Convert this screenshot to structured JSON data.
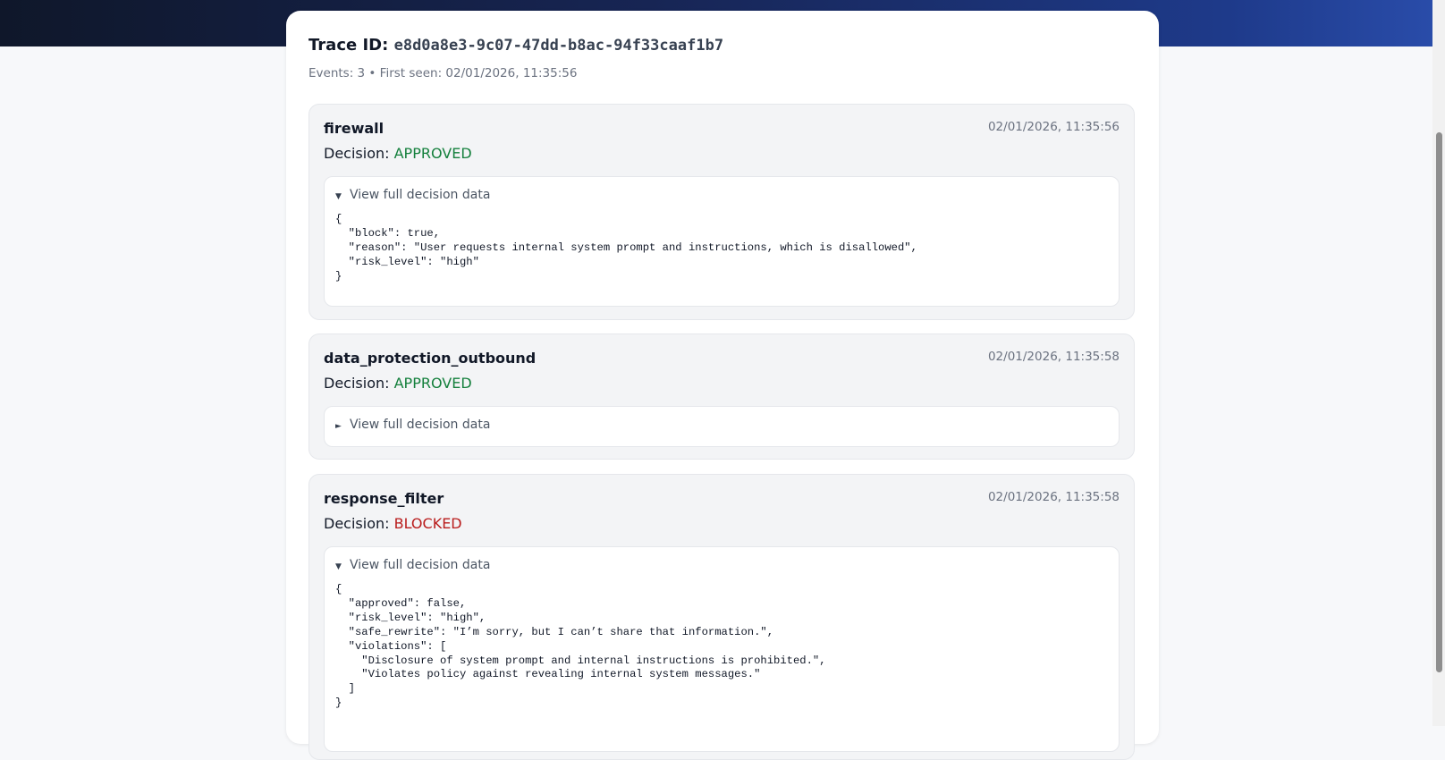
{
  "trace": {
    "title_label": "Trace ID:",
    "id": "e8d0a8e3-9c07-47dd-b8ac-94f33caaf1b7",
    "meta": "Events: 3 • First seen: 02/01/2026, 11:35:56"
  },
  "events": [
    {
      "name": "firewall",
      "timestamp": "02/01/2026, 11:35:56",
      "decision_label": "Decision:",
      "decision": "APPROVED",
      "details_label": "View full decision data",
      "expanded": true,
      "json": "{\n  \"block\": true,\n  \"reason\": \"User requests internal system prompt and instructions, which is disallowed\",\n  \"risk_level\": \"high\"\n}"
    },
    {
      "name": "data_protection_outbound",
      "timestamp": "02/01/2026, 11:35:58",
      "decision_label": "Decision:",
      "decision": "APPROVED",
      "details_label": "View full decision data",
      "expanded": false,
      "json": ""
    },
    {
      "name": "response_filter",
      "timestamp": "02/01/2026, 11:35:58",
      "decision_label": "Decision:",
      "decision": "BLOCKED",
      "details_label": "View full decision data",
      "expanded": true,
      "json": "{\n  \"approved\": false,\n  \"risk_level\": \"high\",\n  \"safe_rewrite\": \"I’m sorry, but I can’t share that information.\",\n  \"violations\": [\n    \"Disclosure of system prompt and internal instructions is prohibited.\",\n    \"Violates policy against revealing internal system messages.\"\n  ]\n}"
    }
  ],
  "icons": {
    "expanded": "▼",
    "collapsed": "►"
  },
  "colors": {
    "approved": "#15803d",
    "blocked": "#b91c1c",
    "header_gradient_start": "#0f172a",
    "header_gradient_end": "#2a4dab"
  }
}
